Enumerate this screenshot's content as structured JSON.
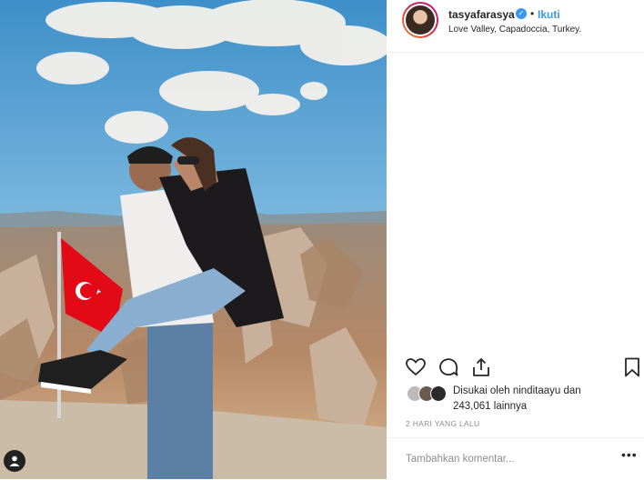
{
  "post": {
    "username": "tasyafarasya",
    "verified_mark": "✓",
    "separator": "•",
    "follow_label": "Ikuti",
    "location": "Love Valley, Capadoccia, Turkey.",
    "likes_line1": "Disukai oleh ninditaayu dan",
    "likes_line2": "243,061 lainnya",
    "timestamp": "2 HARI YANG LALU",
    "comment_placeholder": "Tambahkan komentar...",
    "more_label": "•••"
  },
  "icons": {
    "photo_tag": "user-tag-icon",
    "like": "heart-icon",
    "comment": "comment-bubble-icon",
    "share": "share-icon",
    "save": "bookmark-icon"
  },
  "colors": {
    "link_blue": "#3897f0",
    "text": "#262626",
    "muted": "#8e8e8e",
    "flag_red": "#e30a17"
  }
}
